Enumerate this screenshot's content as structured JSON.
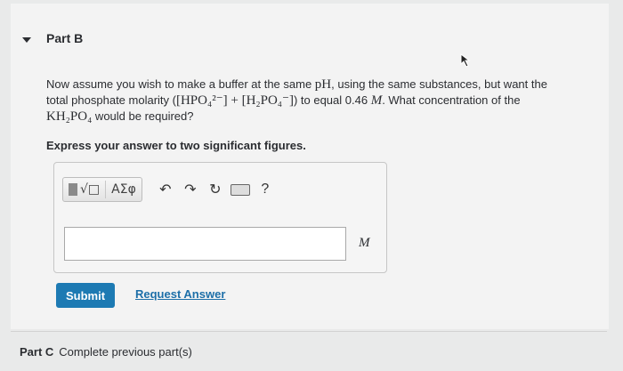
{
  "part_b": {
    "title": "Part B",
    "question_line1_pre": "Now assume you wish to make a buffer at the same ",
    "question_ph": "pH",
    "question_line1_post": ", using the same substances, but want the",
    "question_line2_pre": "total phosphate molarity (",
    "question_formula": "[HPO₄²⁻] + [H₂PO₄⁻]",
    "question_line2_mid": ") to equal 0.46 ",
    "question_unit": "M",
    "question_line2_post": ". What concentration of the",
    "question_line3_formula": "KH₂PO₄",
    "question_line3_post": " would be required?",
    "instruction": "Express your answer to two significant figures."
  },
  "toolbar": {
    "greek_label": "ΑΣφ",
    "help_label": "?",
    "undo_icon": "↶",
    "redo_icon": "↷",
    "reset_icon": "↻"
  },
  "answer": {
    "value": "",
    "unit": "M"
  },
  "actions": {
    "submit_label": "Submit",
    "request_label": "Request Answer"
  },
  "part_c": {
    "title": "Part C",
    "status": "Complete previous part(s)"
  }
}
